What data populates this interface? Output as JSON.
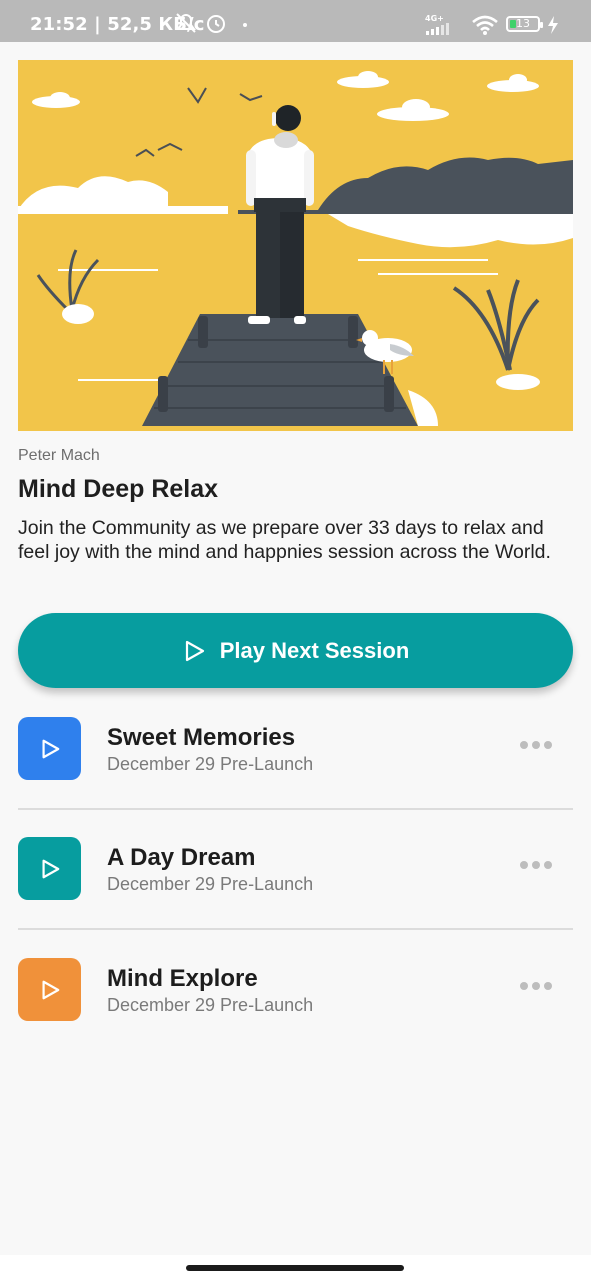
{
  "status_bar": {
    "text": "21:52 | 52,5 КБ/с",
    "network": "4G+",
    "battery": "13"
  },
  "hero": {
    "icon": "meditation-illustration"
  },
  "author": "Peter Mach",
  "title": "Mind Deep Relax",
  "description": "Join the Community as we prepare over 33 days to relax and feel joy with the mind and happnies session across the World.",
  "play_button": {
    "label": "Play Next Session",
    "icon": "play-outline-icon",
    "color": "#079d9f"
  },
  "sessions": [
    {
      "title": "Sweet Memories",
      "subtitle": "December 29 Pre-Launch",
      "color": "#2f80ed"
    },
    {
      "title": "A Day Dream",
      "subtitle": "December 29 Pre-Launch",
      "color": "#079d9f"
    },
    {
      "title": "Mind Explore",
      "subtitle": "December 29 Pre-Launch",
      "color": "#f0913a"
    }
  ]
}
